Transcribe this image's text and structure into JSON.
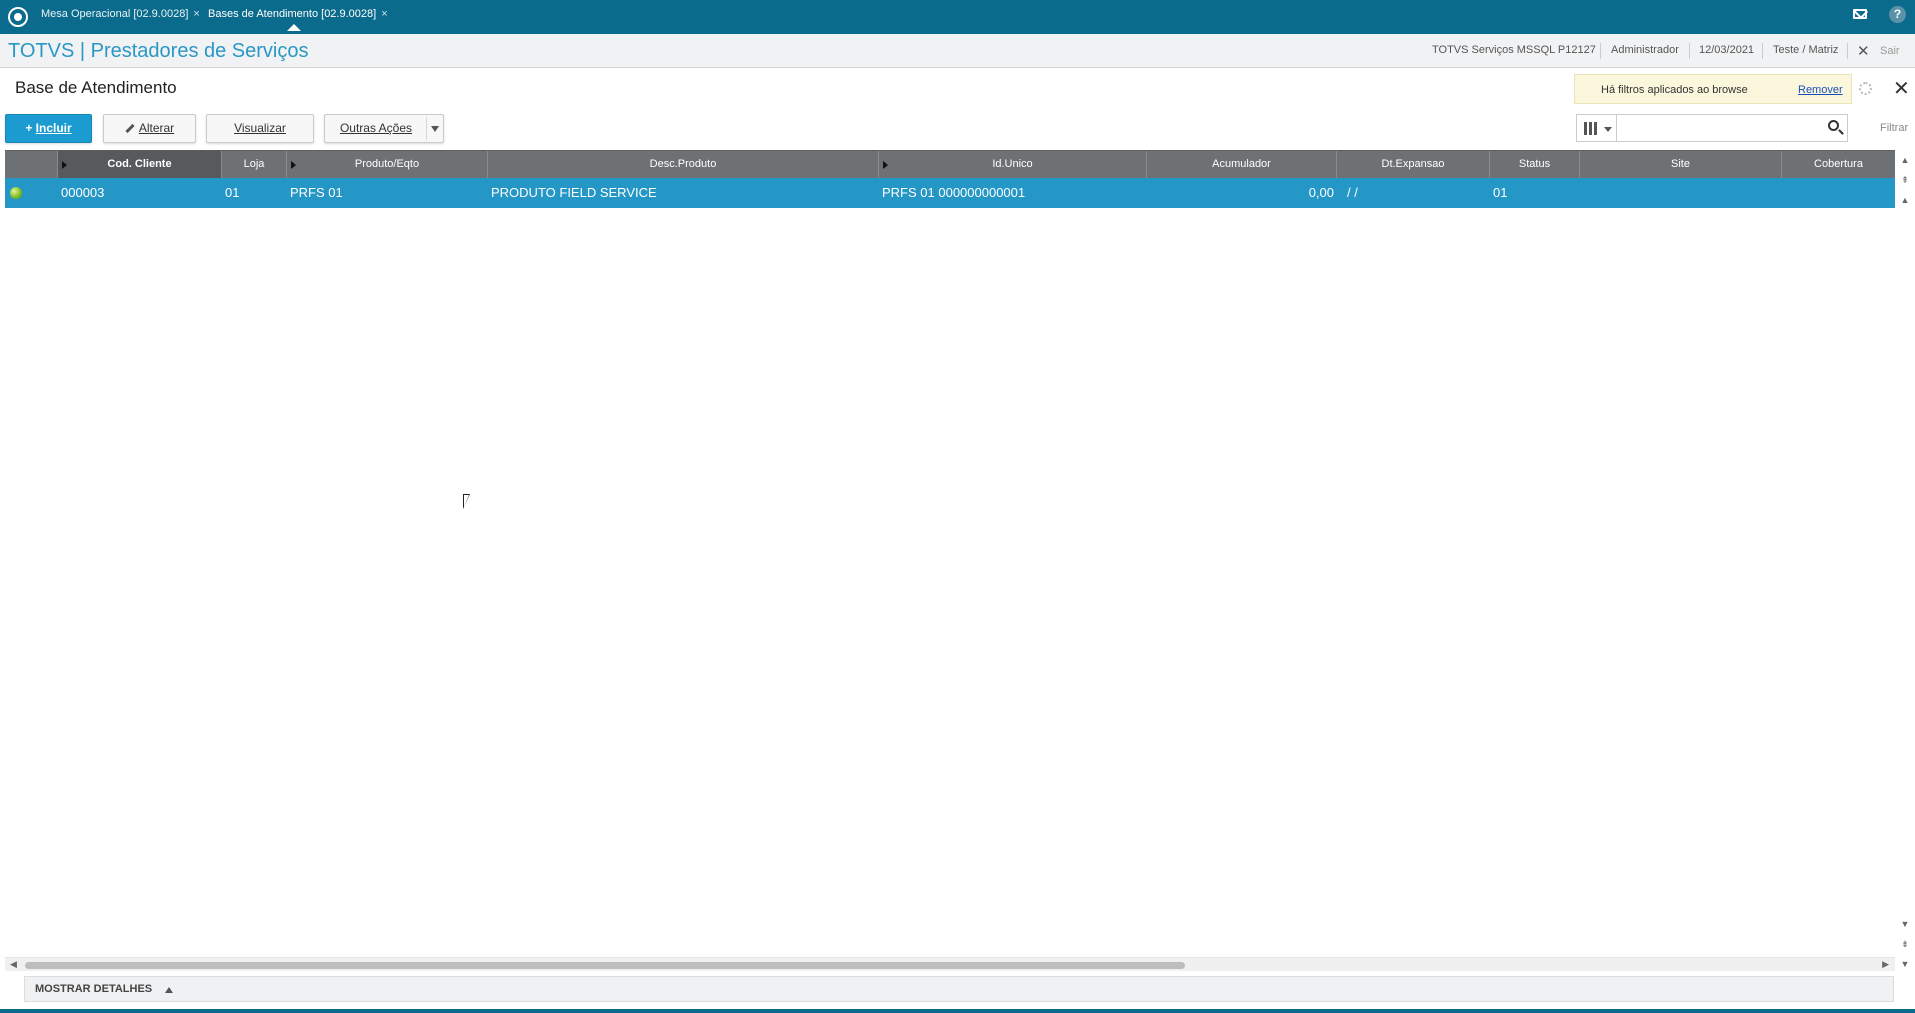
{
  "topbar": {
    "tabs": [
      {
        "label": "Mesa Operacional [02.9.0028]"
      },
      {
        "label": "Bases de Atendimento [02.9.0028]"
      }
    ],
    "close_glyph": "×"
  },
  "header": {
    "title": "TOTVS | Prestadores de Serviços",
    "environment": "TOTVS Serviços MSSQL P12127",
    "user": "Administrador",
    "date": "12/03/2021",
    "branch": "Teste / Matriz",
    "exit_label": "Sair"
  },
  "page": {
    "title": "Base de Atendimento",
    "notice": {
      "text": "Há filtros aplicados ao browse",
      "link": "Remover"
    }
  },
  "toolbar": {
    "include_label": "Incluir",
    "edit_label": "Alterar",
    "view_label": "Visualizar",
    "more_label": "Outras Ações",
    "filter_label": "Filtrar",
    "search_value": ""
  },
  "grid": {
    "columns": [
      "Cod. Cliente",
      "Loja",
      "Produto/Eqto",
      "Desc.Produto",
      "Id.Unico",
      "Acumulador",
      "Dt.Expansao",
      "Status",
      "Site",
      "Cobertura"
    ],
    "rows": [
      {
        "status_color": "#7cba1c",
        "cod_cliente": "000003",
        "loja": "01",
        "produto": "PRFS 01",
        "desc_produto": "PRODUTO FIELD SERVICE",
        "id_unico": "PRFS 01 000000000001",
        "acumulador": "0,00",
        "dt_expansao": "/ /",
        "status": "01",
        "site": "",
        "cobertura": ""
      }
    ]
  },
  "footer": {
    "details_label": "MOSTRAR DETALHES"
  },
  "colors": {
    "brand": "#0b6b8c",
    "accent": "#2497c7",
    "selected_row": "#2497c7",
    "header_row": "#6e7173"
  }
}
